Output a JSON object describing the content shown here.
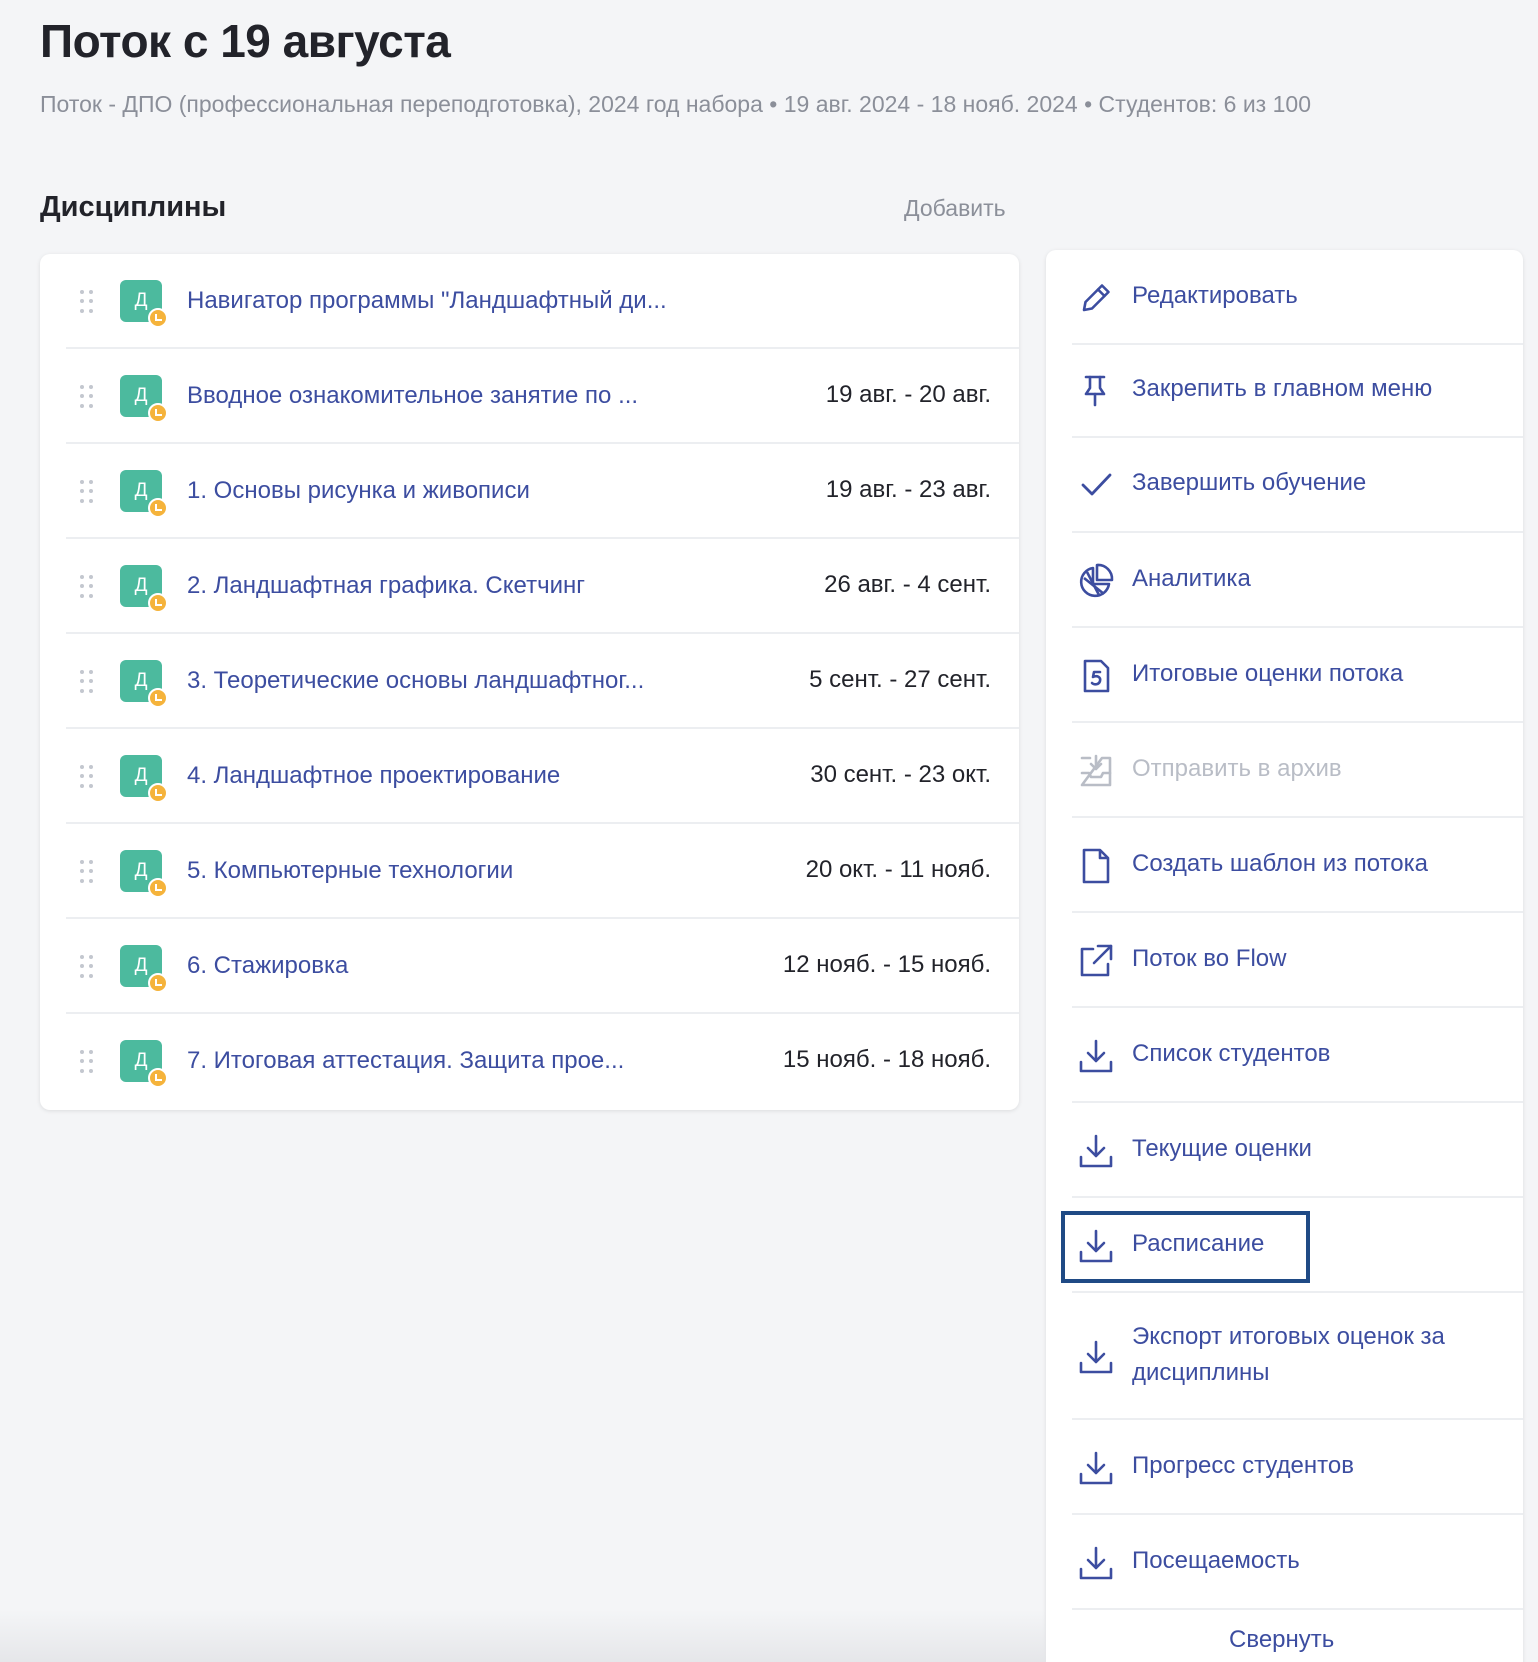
{
  "header": {
    "title": "Поток с 19 августа",
    "subtitle": "Поток - ДПО (профессиональная переподготовка), 2024 год набора • 19 авг. 2024 - 18 нояб. 2024 • Студентов: 6 из 100"
  },
  "disciplines": {
    "title": "Дисциплины",
    "add_label": "Добавить",
    "badge_letter": "Д",
    "items": [
      {
        "name": "Навигатор программы \"Ландшафтный ди...",
        "dates": ""
      },
      {
        "name": "Вводное ознакомительное занятие по ...",
        "dates": "19 авг. - 20 авг."
      },
      {
        "name": "1. Основы рисунка и живописи",
        "dates": "19 авг. - 23 авг."
      },
      {
        "name": "2. Ландшафтная графика. Скетчинг",
        "dates": "26 авг. - 4 сент."
      },
      {
        "name": "3. Теоретические основы ландшафтног...",
        "dates": "5 сент. - 27 сент."
      },
      {
        "name": "4. Ландшафтное проектирование",
        "dates": "30 сент. - 23 окт."
      },
      {
        "name": "5. Компьютерные технологии",
        "dates": "20 окт. - 11 нояб."
      },
      {
        "name": "6. Стажировка",
        "dates": "12 нояб. - 15 нояб."
      },
      {
        "name": "7. Итоговая аттестация. Защита прое...",
        "dates": "15 нояб. - 18 нояб."
      }
    ]
  },
  "actions": {
    "items": [
      {
        "label": "Редактировать",
        "icon": "pencil-icon"
      },
      {
        "label": "Закрепить в главном меню",
        "icon": "pin-icon"
      },
      {
        "label": "Завершить обучение",
        "icon": "check-icon"
      },
      {
        "label": "Аналитика",
        "icon": "pie-chart-icon"
      },
      {
        "label": "Итоговые оценки потока",
        "icon": "grade-document-icon"
      },
      {
        "label": "Отправить в архив",
        "icon": "archive-icon",
        "disabled": true
      },
      {
        "label": "Создать шаблон из потока",
        "icon": "document-icon"
      },
      {
        "label": "Поток во Flow",
        "icon": "external-link-icon"
      },
      {
        "label": "Список студентов",
        "icon": "download-icon"
      },
      {
        "label": "Текущие оценки",
        "icon": "download-icon"
      },
      {
        "label": "Расписание",
        "icon": "download-icon",
        "focused": true
      },
      {
        "label": "Экспорт итоговых оценок за дисциплины",
        "icon": "download-icon"
      },
      {
        "label": "Прогресс студентов",
        "icon": "download-icon"
      },
      {
        "label": "Посещаемость",
        "icon": "download-icon"
      }
    ],
    "collapse_label": "Свернуть"
  },
  "colors": {
    "accent": "#3c4da0",
    "badge_green": "#4cba9e",
    "badge_dot_orange": "#f5b33b",
    "disabled": "#b9bdc6",
    "focus_frame": "#1f4a85",
    "background": "#f4f5f7"
  }
}
